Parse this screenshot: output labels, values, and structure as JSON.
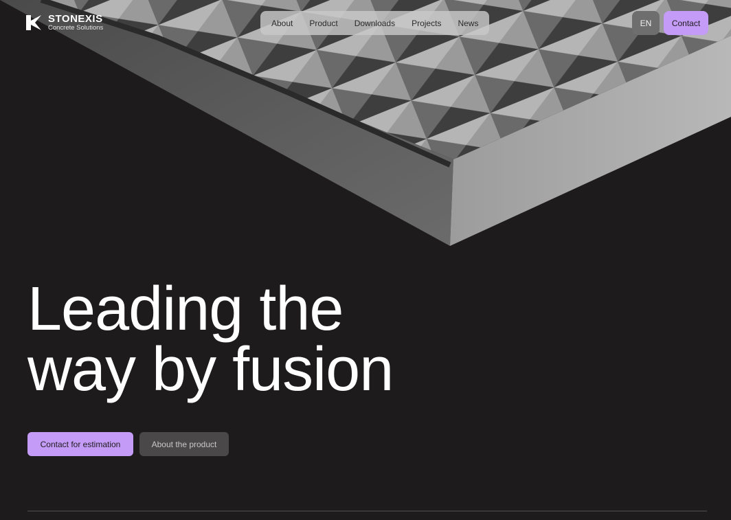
{
  "brand": {
    "name": "STONEXIS",
    "tagline": "Concrete Solutions"
  },
  "nav": {
    "items": [
      {
        "label": "About"
      },
      {
        "label": "Product"
      },
      {
        "label": "Downloads"
      },
      {
        "label": "Projects"
      },
      {
        "label": "News"
      }
    ]
  },
  "header": {
    "language": "EN",
    "contact_label": "Contact"
  },
  "hero": {
    "headline_line1": "Leading the",
    "headline_line2": "way by fusion",
    "primary_cta": "Contact for estimation",
    "secondary_cta": "About the product"
  },
  "colors": {
    "background": "#1d1b1c",
    "accent": "#c49cf7",
    "nav_bg": "#c8c8c8",
    "secondary_button": "#4a4849"
  }
}
